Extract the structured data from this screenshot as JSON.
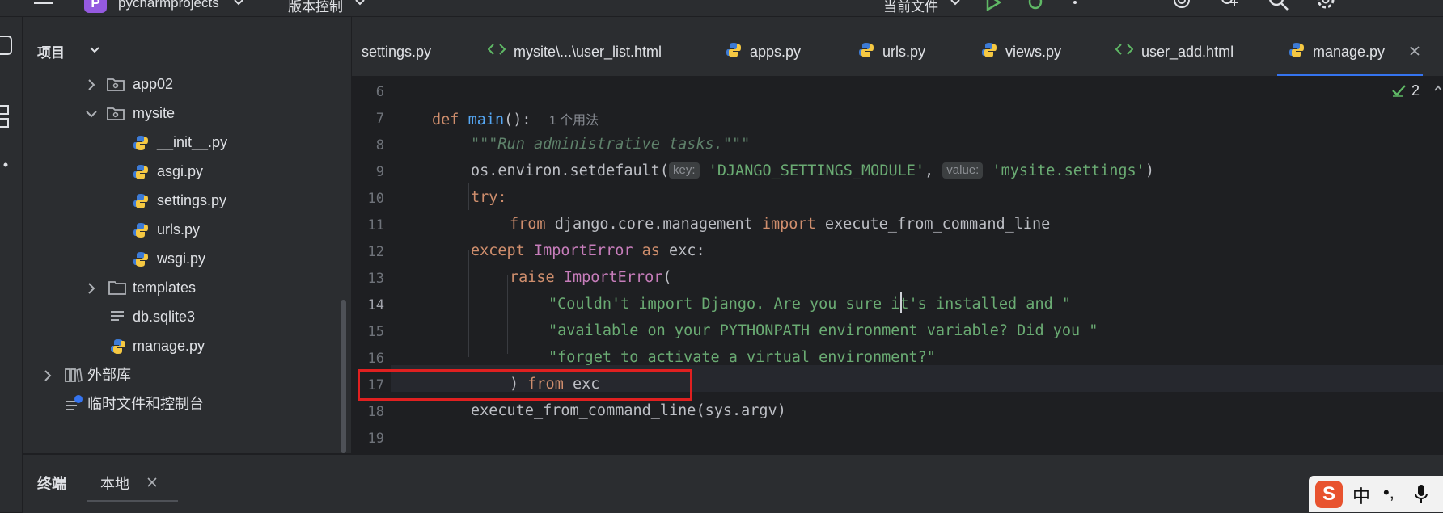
{
  "topbar": {
    "project_badge": "P",
    "project_name": "pycharmprojects",
    "vcs_label": "版本控制",
    "run_config": "当前文件"
  },
  "project_panel": {
    "title": "项目",
    "tree": [
      {
        "label": "app02",
        "icon": "folder-icon",
        "expanded": false
      },
      {
        "label": "mysite",
        "icon": "folder-icon",
        "expanded": true
      },
      {
        "label": "__init__.py",
        "icon": "python-file-icon"
      },
      {
        "label": "asgi.py",
        "icon": "python-file-icon"
      },
      {
        "label": "settings.py",
        "icon": "python-file-icon"
      },
      {
        "label": "urls.py",
        "icon": "python-file-icon"
      },
      {
        "label": "wsgi.py",
        "icon": "python-file-icon"
      },
      {
        "label": "templates",
        "icon": "folder-icon",
        "expanded": false
      },
      {
        "label": "db.sqlite3",
        "icon": "text-file-icon"
      },
      {
        "label": "manage.py",
        "icon": "python-file-icon"
      },
      {
        "label": "外部库",
        "icon": "library-icon",
        "expanded": false
      },
      {
        "label": "临时文件和控制台",
        "icon": "scratch-icon"
      }
    ]
  },
  "tabs": [
    {
      "label": "settings.py",
      "icon": "none"
    },
    {
      "label": "mysite\\...\\user_list.html",
      "icon": "html-icon"
    },
    {
      "label": "apps.py",
      "icon": "python-file-icon"
    },
    {
      "label": "urls.py",
      "icon": "python-file-icon"
    },
    {
      "label": "views.py",
      "icon": "python-file-icon"
    },
    {
      "label": "user_add.html",
      "icon": "html-icon"
    },
    {
      "label": "manage.py",
      "icon": "python-file-icon",
      "active": true
    }
  ],
  "editor": {
    "inspection_count": "2",
    "usage_hint": "1 个用法",
    "hint_key": "key:",
    "hint_value": "value:",
    "current_line": 14,
    "lines": [
      {
        "n": "6"
      },
      {
        "n": "7"
      },
      {
        "n": "8"
      },
      {
        "n": "9"
      },
      {
        "n": "10"
      },
      {
        "n": "11"
      },
      {
        "n": "12"
      },
      {
        "n": "13"
      },
      {
        "n": "14"
      },
      {
        "n": "15"
      },
      {
        "n": "16"
      },
      {
        "n": "17"
      },
      {
        "n": "18"
      },
      {
        "n": "19"
      }
    ],
    "tokens": {
      "def": "def",
      "main": "main",
      "main_paren": "():",
      "docstring": "\"\"\"Run administrative tasks.\"\"\"",
      "os_environ": "os.environ.setdefault(",
      "settings_module": "'DJANGO_SETTINGS_MODULE'",
      "comma": ", ",
      "settings_value": "'mysite.settings'",
      "close_paren": ")",
      "try": "try:",
      "from": "from",
      "module": " django.core.management ",
      "import": "import",
      "imported": " execute_from_command_line",
      "except": "except",
      "import_error": "ImportError",
      "as": "as",
      "exc_colon": " exc:",
      "raise": "raise",
      "open_paren": "(",
      "str1": "\"Couldn't import Django. Are you sure it's installed and \"",
      "str2": "\"available on your PYTHONPATH environment variable? Did you \"",
      "str3": "\"forget to activate a virtual environment?\"",
      "close_from": ") ",
      "exc": " exc",
      "call": "execute_from_command_line(sys.argv)"
    }
  },
  "bottom": {
    "terminal_label": "终端",
    "local_tab": "本地"
  },
  "ime": {
    "logo": "S",
    "mode": "中",
    "punct": "•,"
  },
  "colors": {
    "accent": "#3574f0",
    "highlight_box": "#e02020",
    "background": "#1e1f22",
    "panel": "#2b2d30"
  }
}
